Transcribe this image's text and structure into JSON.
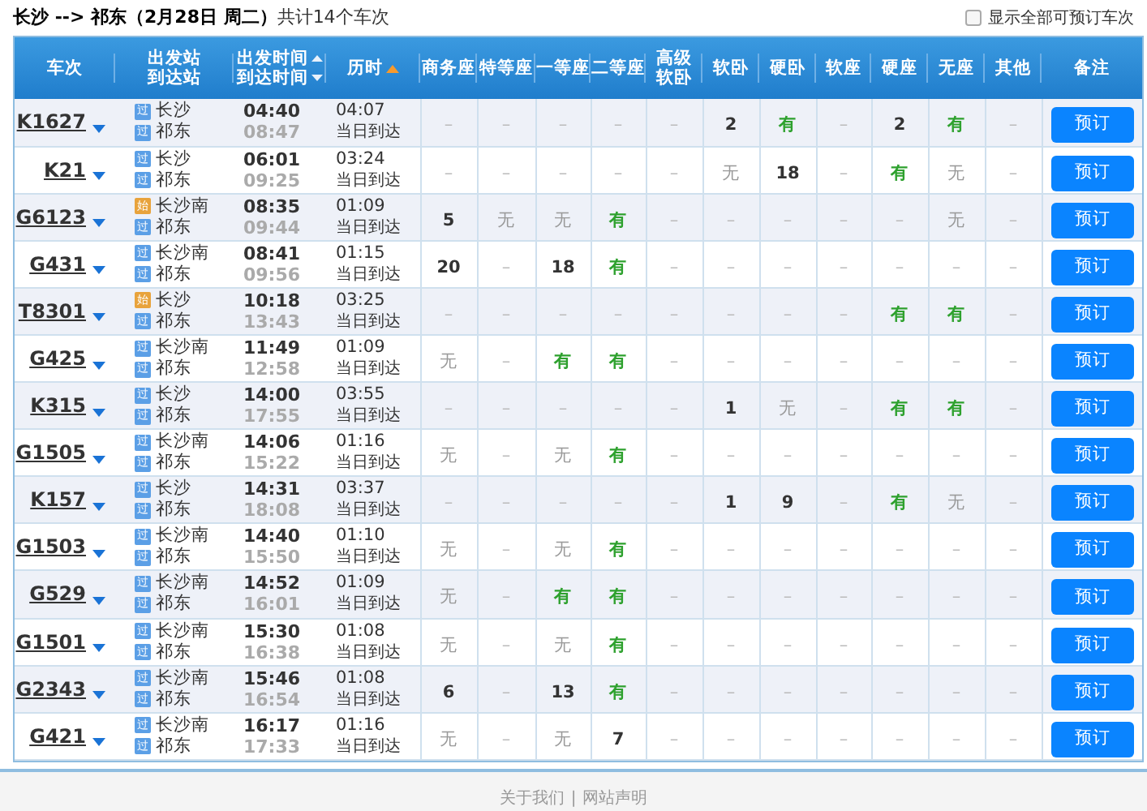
{
  "summary": {
    "route": "长沙 --> 祁东（2月28日  周二）",
    "count": "共计14个车次"
  },
  "show_all": {
    "label": "显示全部可预订车次",
    "checked": false
  },
  "columns": [
    {
      "label": "车次"
    },
    {
      "label": "出发站",
      "label2": "到达站"
    },
    {
      "label": "出发时间",
      "label2": "到达时间",
      "kind": "sortable"
    },
    {
      "label": "历时",
      "kind": "sorted"
    },
    {
      "label": "商务座"
    },
    {
      "label": "特等座"
    },
    {
      "label": "一等座"
    },
    {
      "label": "二等座"
    },
    {
      "label": "高级",
      "label2": "软卧"
    },
    {
      "label": "软卧"
    },
    {
      "label": "硬卧"
    },
    {
      "label": "软座"
    },
    {
      "label": "硬座"
    },
    {
      "label": "无座"
    },
    {
      "label": "其他"
    },
    {
      "label": "备注"
    }
  ],
  "trains": [
    {
      "number": "K1627",
      "from": {
        "badge": "过",
        "kind": "pass",
        "name": "长沙"
      },
      "to": {
        "badge": "过",
        "kind": "pass",
        "name": "祁东"
      },
      "depart": "04:40",
      "arrive": "08:47",
      "duration": "04:07",
      "arrival_note": "当日到达",
      "seats": [
        {
          "text": "–",
          "kind": "na"
        },
        {
          "text": "–",
          "kind": "na"
        },
        {
          "text": "–",
          "kind": "na"
        },
        {
          "text": "–",
          "kind": "na"
        },
        {
          "text": "–",
          "kind": "na"
        },
        {
          "text": "2",
          "kind": "count"
        },
        {
          "text": "有",
          "kind": "yes"
        },
        {
          "text": "–",
          "kind": "na"
        },
        {
          "text": "2",
          "kind": "count"
        },
        {
          "text": "有",
          "kind": "yes"
        },
        {
          "text": "–",
          "kind": "na"
        }
      ],
      "button": "预订"
    },
    {
      "number": "K21",
      "from": {
        "badge": "过",
        "kind": "pass",
        "name": "长沙"
      },
      "to": {
        "badge": "过",
        "kind": "pass",
        "name": "祁东"
      },
      "depart": "06:01",
      "arrive": "09:25",
      "duration": "03:24",
      "arrival_note": "当日到达",
      "seats": [
        {
          "text": "–",
          "kind": "na"
        },
        {
          "text": "–",
          "kind": "na"
        },
        {
          "text": "–",
          "kind": "na"
        },
        {
          "text": "–",
          "kind": "na"
        },
        {
          "text": "–",
          "kind": "na"
        },
        {
          "text": "无",
          "kind": "no"
        },
        {
          "text": "18",
          "kind": "count"
        },
        {
          "text": "–",
          "kind": "na"
        },
        {
          "text": "有",
          "kind": "yes"
        },
        {
          "text": "无",
          "kind": "no"
        },
        {
          "text": "–",
          "kind": "na"
        }
      ],
      "button": "预订"
    },
    {
      "number": "G6123",
      "from": {
        "badge": "始",
        "kind": "origin",
        "name": "长沙南"
      },
      "to": {
        "badge": "过",
        "kind": "pass",
        "name": "祁东"
      },
      "depart": "08:35",
      "arrive": "09:44",
      "duration": "01:09",
      "arrival_note": "当日到达",
      "seats": [
        {
          "text": "5",
          "kind": "count"
        },
        {
          "text": "无",
          "kind": "no"
        },
        {
          "text": "无",
          "kind": "no"
        },
        {
          "text": "有",
          "kind": "yes"
        },
        {
          "text": "–",
          "kind": "na"
        },
        {
          "text": "–",
          "kind": "na"
        },
        {
          "text": "–",
          "kind": "na"
        },
        {
          "text": "–",
          "kind": "na"
        },
        {
          "text": "–",
          "kind": "na"
        },
        {
          "text": "无",
          "kind": "no"
        },
        {
          "text": "–",
          "kind": "na"
        }
      ],
      "button": "预订"
    },
    {
      "number": "G431",
      "from": {
        "badge": "过",
        "kind": "pass",
        "name": "长沙南"
      },
      "to": {
        "badge": "过",
        "kind": "pass",
        "name": "祁东"
      },
      "depart": "08:41",
      "arrive": "09:56",
      "duration": "01:15",
      "arrival_note": "当日到达",
      "seats": [
        {
          "text": "20",
          "kind": "count"
        },
        {
          "text": "–",
          "kind": "na"
        },
        {
          "text": "18",
          "kind": "count"
        },
        {
          "text": "有",
          "kind": "yes"
        },
        {
          "text": "–",
          "kind": "na"
        },
        {
          "text": "–",
          "kind": "na"
        },
        {
          "text": "–",
          "kind": "na"
        },
        {
          "text": "–",
          "kind": "na"
        },
        {
          "text": "–",
          "kind": "na"
        },
        {
          "text": "–",
          "kind": "na"
        },
        {
          "text": "–",
          "kind": "na"
        }
      ],
      "button": "预订"
    },
    {
      "number": "T8301",
      "from": {
        "badge": "始",
        "kind": "origin",
        "name": "长沙"
      },
      "to": {
        "badge": "过",
        "kind": "pass",
        "name": "祁东"
      },
      "depart": "10:18",
      "arrive": "13:43",
      "duration": "03:25",
      "arrival_note": "当日到达",
      "seats": [
        {
          "text": "–",
          "kind": "na"
        },
        {
          "text": "–",
          "kind": "na"
        },
        {
          "text": "–",
          "kind": "na"
        },
        {
          "text": "–",
          "kind": "na"
        },
        {
          "text": "–",
          "kind": "na"
        },
        {
          "text": "–",
          "kind": "na"
        },
        {
          "text": "–",
          "kind": "na"
        },
        {
          "text": "–",
          "kind": "na"
        },
        {
          "text": "有",
          "kind": "yes"
        },
        {
          "text": "有",
          "kind": "yes"
        },
        {
          "text": "–",
          "kind": "na"
        }
      ],
      "button": "预订"
    },
    {
      "number": "G425",
      "from": {
        "badge": "过",
        "kind": "pass",
        "name": "长沙南"
      },
      "to": {
        "badge": "过",
        "kind": "pass",
        "name": "祁东"
      },
      "depart": "11:49",
      "arrive": "12:58",
      "duration": "01:09",
      "arrival_note": "当日到达",
      "seats": [
        {
          "text": "无",
          "kind": "no"
        },
        {
          "text": "–",
          "kind": "na"
        },
        {
          "text": "有",
          "kind": "yes"
        },
        {
          "text": "有",
          "kind": "yes"
        },
        {
          "text": "–",
          "kind": "na"
        },
        {
          "text": "–",
          "kind": "na"
        },
        {
          "text": "–",
          "kind": "na"
        },
        {
          "text": "–",
          "kind": "na"
        },
        {
          "text": "–",
          "kind": "na"
        },
        {
          "text": "–",
          "kind": "na"
        },
        {
          "text": "–",
          "kind": "na"
        }
      ],
      "button": "预订"
    },
    {
      "number": "K315",
      "from": {
        "badge": "过",
        "kind": "pass",
        "name": "长沙"
      },
      "to": {
        "badge": "过",
        "kind": "pass",
        "name": "祁东"
      },
      "depart": "14:00",
      "arrive": "17:55",
      "duration": "03:55",
      "arrival_note": "当日到达",
      "seats": [
        {
          "text": "–",
          "kind": "na"
        },
        {
          "text": "–",
          "kind": "na"
        },
        {
          "text": "–",
          "kind": "na"
        },
        {
          "text": "–",
          "kind": "na"
        },
        {
          "text": "–",
          "kind": "na"
        },
        {
          "text": "1",
          "kind": "count"
        },
        {
          "text": "无",
          "kind": "no"
        },
        {
          "text": "–",
          "kind": "na"
        },
        {
          "text": "有",
          "kind": "yes"
        },
        {
          "text": "有",
          "kind": "yes"
        },
        {
          "text": "–",
          "kind": "na"
        }
      ],
      "button": "预订"
    },
    {
      "number": "G1505",
      "from": {
        "badge": "过",
        "kind": "pass",
        "name": "长沙南"
      },
      "to": {
        "badge": "过",
        "kind": "pass",
        "name": "祁东"
      },
      "depart": "14:06",
      "arrive": "15:22",
      "duration": "01:16",
      "arrival_note": "当日到达",
      "seats": [
        {
          "text": "无",
          "kind": "no"
        },
        {
          "text": "–",
          "kind": "na"
        },
        {
          "text": "无",
          "kind": "no"
        },
        {
          "text": "有",
          "kind": "yes"
        },
        {
          "text": "–",
          "kind": "na"
        },
        {
          "text": "–",
          "kind": "na"
        },
        {
          "text": "–",
          "kind": "na"
        },
        {
          "text": "–",
          "kind": "na"
        },
        {
          "text": "–",
          "kind": "na"
        },
        {
          "text": "–",
          "kind": "na"
        },
        {
          "text": "–",
          "kind": "na"
        }
      ],
      "button": "预订"
    },
    {
      "number": "K157",
      "from": {
        "badge": "过",
        "kind": "pass",
        "name": "长沙"
      },
      "to": {
        "badge": "过",
        "kind": "pass",
        "name": "祁东"
      },
      "depart": "14:31",
      "arrive": "18:08",
      "duration": "03:37",
      "arrival_note": "当日到达",
      "seats": [
        {
          "text": "–",
          "kind": "na"
        },
        {
          "text": "–",
          "kind": "na"
        },
        {
          "text": "–",
          "kind": "na"
        },
        {
          "text": "–",
          "kind": "na"
        },
        {
          "text": "–",
          "kind": "na"
        },
        {
          "text": "1",
          "kind": "count"
        },
        {
          "text": "9",
          "kind": "count"
        },
        {
          "text": "–",
          "kind": "na"
        },
        {
          "text": "有",
          "kind": "yes"
        },
        {
          "text": "无",
          "kind": "no"
        },
        {
          "text": "–",
          "kind": "na"
        }
      ],
      "button": "预订"
    },
    {
      "number": "G1503",
      "from": {
        "badge": "过",
        "kind": "pass",
        "name": "长沙南"
      },
      "to": {
        "badge": "过",
        "kind": "pass",
        "name": "祁东"
      },
      "depart": "14:40",
      "arrive": "15:50",
      "duration": "01:10",
      "arrival_note": "当日到达",
      "seats": [
        {
          "text": "无",
          "kind": "no"
        },
        {
          "text": "–",
          "kind": "na"
        },
        {
          "text": "无",
          "kind": "no"
        },
        {
          "text": "有",
          "kind": "yes"
        },
        {
          "text": "–",
          "kind": "na"
        },
        {
          "text": "–",
          "kind": "na"
        },
        {
          "text": "–",
          "kind": "na"
        },
        {
          "text": "–",
          "kind": "na"
        },
        {
          "text": "–",
          "kind": "na"
        },
        {
          "text": "–",
          "kind": "na"
        },
        {
          "text": "–",
          "kind": "na"
        }
      ],
      "button": "预订"
    },
    {
      "number": "G529",
      "from": {
        "badge": "过",
        "kind": "pass",
        "name": "长沙南"
      },
      "to": {
        "badge": "过",
        "kind": "pass",
        "name": "祁东"
      },
      "depart": "14:52",
      "arrive": "16:01",
      "duration": "01:09",
      "arrival_note": "当日到达",
      "seats": [
        {
          "text": "无",
          "kind": "no"
        },
        {
          "text": "–",
          "kind": "na"
        },
        {
          "text": "有",
          "kind": "yes"
        },
        {
          "text": "有",
          "kind": "yes"
        },
        {
          "text": "–",
          "kind": "na"
        },
        {
          "text": "–",
          "kind": "na"
        },
        {
          "text": "–",
          "kind": "na"
        },
        {
          "text": "–",
          "kind": "na"
        },
        {
          "text": "–",
          "kind": "na"
        },
        {
          "text": "–",
          "kind": "na"
        },
        {
          "text": "–",
          "kind": "na"
        }
      ],
      "button": "预订"
    },
    {
      "number": "G1501",
      "from": {
        "badge": "过",
        "kind": "pass",
        "name": "长沙南"
      },
      "to": {
        "badge": "过",
        "kind": "pass",
        "name": "祁东"
      },
      "depart": "15:30",
      "arrive": "16:38",
      "duration": "01:08",
      "arrival_note": "当日到达",
      "seats": [
        {
          "text": "无",
          "kind": "no"
        },
        {
          "text": "–",
          "kind": "na"
        },
        {
          "text": "无",
          "kind": "no"
        },
        {
          "text": "有",
          "kind": "yes"
        },
        {
          "text": "–",
          "kind": "na"
        },
        {
          "text": "–",
          "kind": "na"
        },
        {
          "text": "–",
          "kind": "na"
        },
        {
          "text": "–",
          "kind": "na"
        },
        {
          "text": "–",
          "kind": "na"
        },
        {
          "text": "–",
          "kind": "na"
        },
        {
          "text": "–",
          "kind": "na"
        }
      ],
      "button": "预订"
    },
    {
      "number": "G2343",
      "from": {
        "badge": "过",
        "kind": "pass",
        "name": "长沙南"
      },
      "to": {
        "badge": "过",
        "kind": "pass",
        "name": "祁东"
      },
      "depart": "15:46",
      "arrive": "16:54",
      "duration": "01:08",
      "arrival_note": "当日到达",
      "seats": [
        {
          "text": "6",
          "kind": "count"
        },
        {
          "text": "–",
          "kind": "na"
        },
        {
          "text": "13",
          "kind": "count"
        },
        {
          "text": "有",
          "kind": "yes"
        },
        {
          "text": "–",
          "kind": "na"
        },
        {
          "text": "–",
          "kind": "na"
        },
        {
          "text": "–",
          "kind": "na"
        },
        {
          "text": "–",
          "kind": "na"
        },
        {
          "text": "–",
          "kind": "na"
        },
        {
          "text": "–",
          "kind": "na"
        },
        {
          "text": "–",
          "kind": "na"
        }
      ],
      "button": "预订"
    },
    {
      "number": "G421",
      "from": {
        "badge": "过",
        "kind": "pass",
        "name": "长沙南"
      },
      "to": {
        "badge": "过",
        "kind": "pass",
        "name": "祁东"
      },
      "depart": "16:17",
      "arrive": "17:33",
      "duration": "01:16",
      "arrival_note": "当日到达",
      "seats": [
        {
          "text": "无",
          "kind": "no"
        },
        {
          "text": "–",
          "kind": "na"
        },
        {
          "text": "无",
          "kind": "no"
        },
        {
          "text": "7",
          "kind": "count"
        },
        {
          "text": "–",
          "kind": "na"
        },
        {
          "text": "–",
          "kind": "na"
        },
        {
          "text": "–",
          "kind": "na"
        },
        {
          "text": "–",
          "kind": "na"
        },
        {
          "text": "–",
          "kind": "na"
        },
        {
          "text": "–",
          "kind": "na"
        },
        {
          "text": "–",
          "kind": "na"
        }
      ],
      "button": "预订"
    }
  ],
  "footer": {
    "links": [
      "关于我们",
      "网站声明"
    ],
    "separator": "|"
  }
}
